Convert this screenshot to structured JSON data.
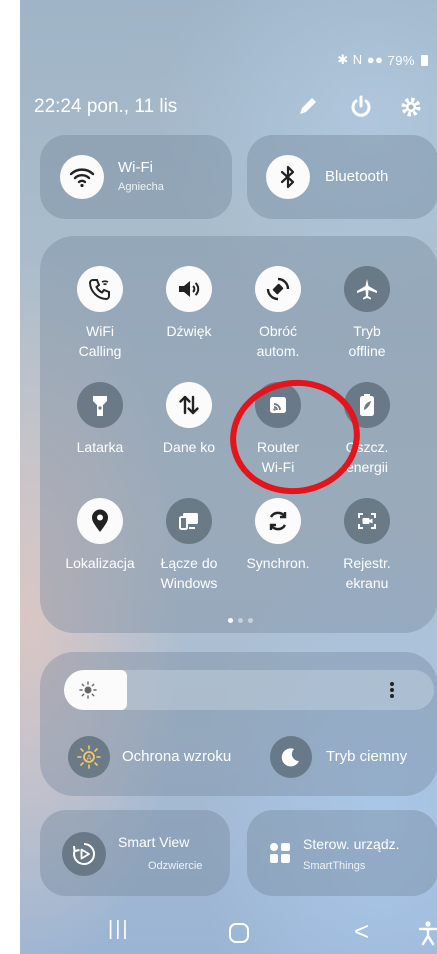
{
  "status": {
    "icons": "✱ N ●●",
    "battery": "79%"
  },
  "header": {
    "datetime": "22:24 pon., 11 lis"
  },
  "wifi": {
    "title": "Wi-Fi",
    "network": "Agniecha"
  },
  "bluetooth": {
    "title": "Bluetooth"
  },
  "tiles": [
    {
      "label": "WiFi\nCalling",
      "icon": "wifi-calling-icon",
      "state": "on"
    },
    {
      "label": "Dźwięk",
      "icon": "sound-icon",
      "state": "on"
    },
    {
      "label": "Obróć\nautom.",
      "icon": "auto-rotate-icon",
      "state": "on"
    },
    {
      "label": "Tryb\noffline",
      "icon": "airplane-icon",
      "state": "off"
    },
    {
      "label": "Latarka",
      "icon": "flashlight-icon",
      "state": "off"
    },
    {
      "label": "Dane ko",
      "icon": "mobile-data-icon",
      "state": "on"
    },
    {
      "label": "Router\nWi-Fi",
      "icon": "hotspot-icon",
      "state": "off"
    },
    {
      "label": "Oszcz.\nenergii",
      "icon": "power-saving-icon",
      "state": "off"
    },
    {
      "label": "Lokalizacja",
      "icon": "location-icon",
      "state": "on"
    },
    {
      "label": "Łącze do\nWindows",
      "icon": "link-to-windows-icon",
      "state": "off"
    },
    {
      "label": "Synchron.",
      "icon": "sync-icon",
      "state": "on"
    },
    {
      "label": "Rejestr.\nekranu",
      "icon": "screen-recorder-icon",
      "state": "off"
    }
  ],
  "brightness": {
    "level": 0.17
  },
  "eye_comfort": {
    "label": "Ochrona wzroku"
  },
  "dark_mode": {
    "label": "Tryb ciemny"
  },
  "smart_view": {
    "title": "Smart View",
    "subtitle": "Odzwiercie"
  },
  "smartthings": {
    "title": "Sterow. urządz.",
    "subtitle": "SmartThings"
  },
  "nav": {
    "recents": "|||",
    "back": "<"
  },
  "colors": {
    "highlight": "#e3141b",
    "tile_on": "#fbfbfb",
    "tile_off": "#5a6976"
  }
}
